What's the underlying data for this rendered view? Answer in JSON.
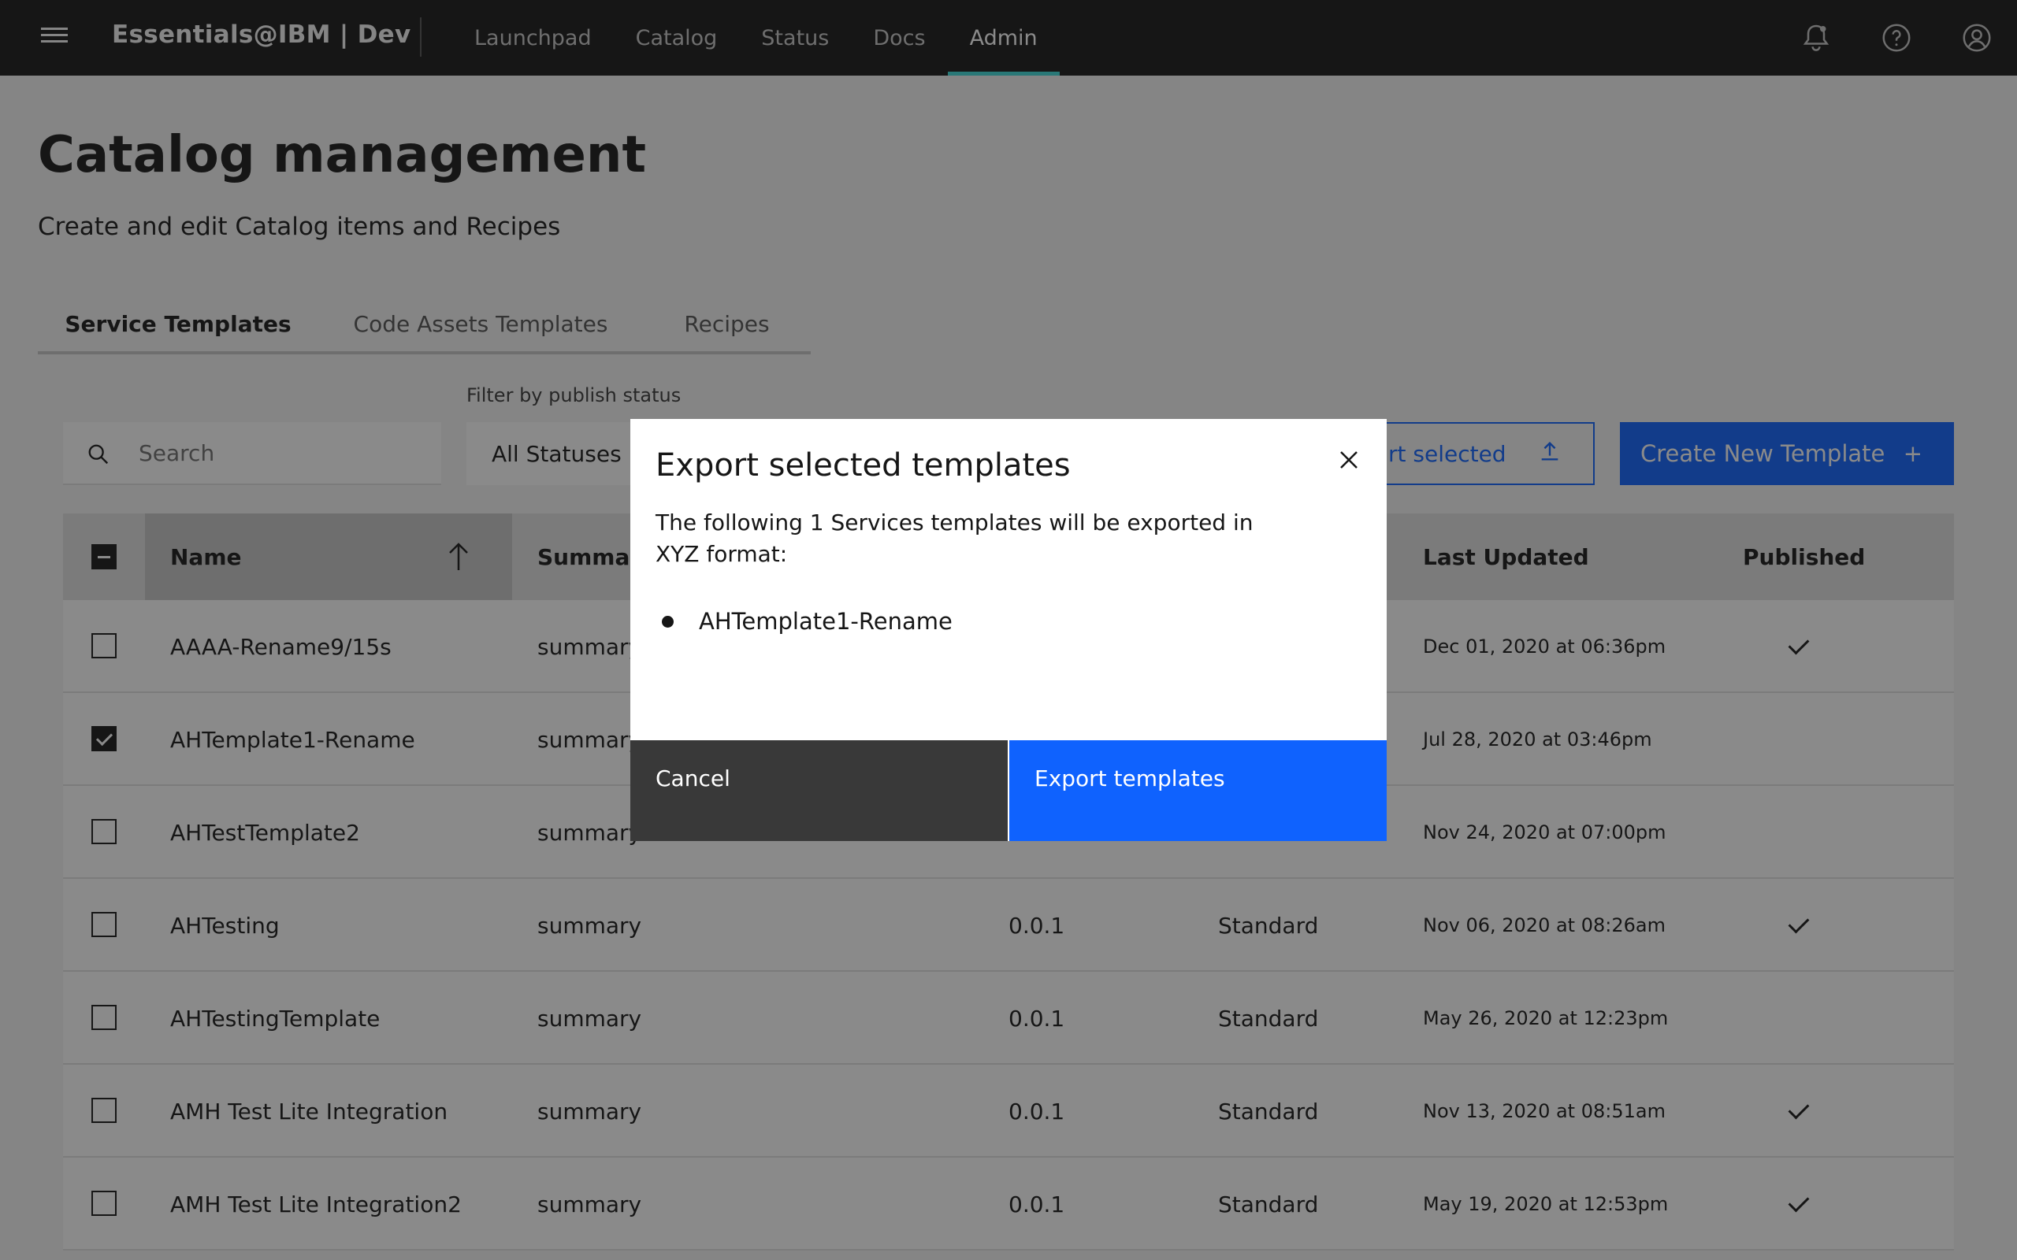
{
  "header": {
    "brand": "Essentials@IBM | Dev",
    "nav": [
      "Launchpad",
      "Catalog",
      "Status",
      "Docs",
      "Admin"
    ],
    "active_nav": "Admin"
  },
  "page": {
    "title": "Catalog management",
    "subtitle": "Create and edit Catalog items and Recipes"
  },
  "tabs": [
    "Service Templates",
    "Code Assets Templates",
    "Recipes"
  ],
  "toolbar": {
    "filter_label": "Filter by publish status",
    "search_placeholder": "Search",
    "status_value": "All Statuses",
    "export_label_partial": "rt selected",
    "create_label": "Create New Template",
    "create_plus": "+"
  },
  "table": {
    "headers": {
      "name": "Name",
      "summary": "Summary",
      "last_updated": "Last Updated",
      "published": "Published"
    },
    "rows": [
      {
        "name": "AAAA-Rename9/15s",
        "summary": "summary",
        "version": "",
        "type": "",
        "updated": "Dec 01, 2020 at 06:36pm",
        "checked": false,
        "published": true
      },
      {
        "name": "AHTemplate1-Rename",
        "summary": "summary",
        "version": "",
        "type": "",
        "updated": "Jul 28, 2020 at 03:46pm",
        "checked": true,
        "published": false
      },
      {
        "name": "AHTestTemplate2",
        "summary": "summary",
        "version": "",
        "type": "",
        "updated": "Nov 24, 2020 at 07:00pm",
        "checked": false,
        "published": false
      },
      {
        "name": "AHTesting",
        "summary": "summary",
        "version": "0.0.1",
        "type": "Standard",
        "updated": "Nov 06, 2020 at 08:26am",
        "checked": false,
        "published": true
      },
      {
        "name": "AHTestingTemplate",
        "summary": "summary",
        "version": "0.0.1",
        "type": "Standard",
        "updated": "May 26, 2020 at 12:23pm",
        "checked": false,
        "published": false
      },
      {
        "name": "AMH Test Lite Integration",
        "summary": "summary",
        "version": "0.0.1",
        "type": "Standard",
        "updated": "Nov 13, 2020 at 08:51am",
        "checked": false,
        "published": true
      },
      {
        "name": "AMH Test Lite Integration2",
        "summary": "summary",
        "version": "0.0.1",
        "type": "Standard",
        "updated": "May 19, 2020 at 12:53pm",
        "checked": false,
        "published": true
      }
    ]
  },
  "modal": {
    "title": "Export selected templates",
    "body": "The following 1 Services templates will be exported in XYZ format:",
    "items": [
      "AHTemplate1-Rename"
    ],
    "cancel_label": "Cancel",
    "confirm_label": "Export templates"
  },
  "colors": {
    "header_bg": "#161616",
    "accent_teal": "#009d9a",
    "primary_blue": "#0f62fe",
    "overlay": "rgba(22,22,22,0.5)"
  }
}
